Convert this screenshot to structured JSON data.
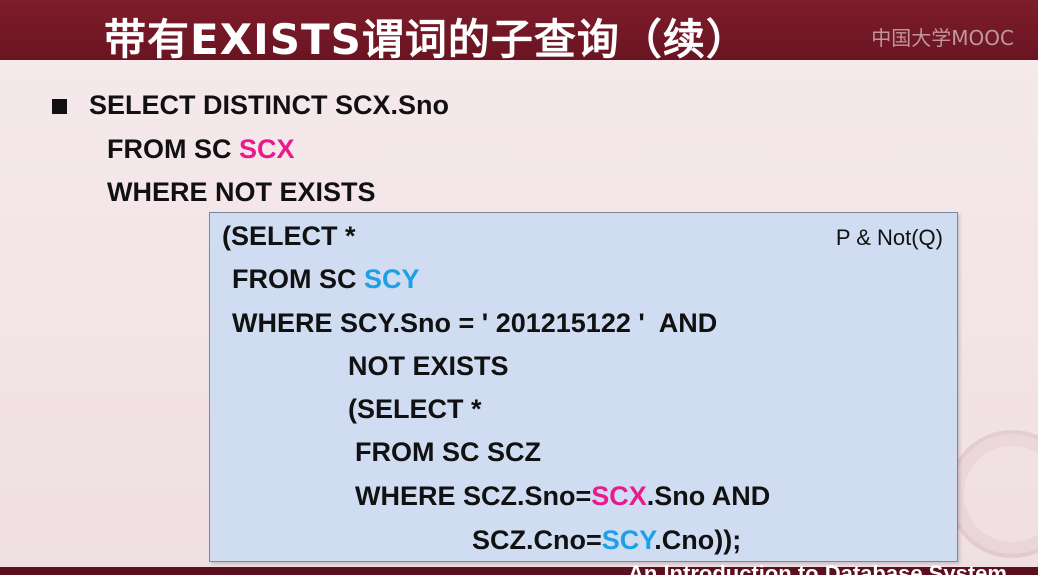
{
  "slide": {
    "title": "带有EXISTS谓词的子查询（续）",
    "watermark": "中国大学MOOC",
    "footer": "An Introduction to Database System"
  },
  "code": {
    "line1": "SELECT DISTINCT SCX.Sno",
    "line2_a": "FROM SC ",
    "line2_b": "SCX",
    "line3": "WHERE NOT EXISTS"
  },
  "subquery": {
    "annotation": "P & Not(Q)",
    "l1": "(SELECT *",
    "l2_a": "FROM SC ",
    "l2_b": "SCY",
    "l3": "WHERE SCY.Sno = ' 201215122 '  AND",
    "l4": "NOT EXISTS",
    "l5": "(SELECT *",
    "l6": "FROM SC SCZ",
    "l7_a": "WHERE SCZ.Sno=",
    "l7_b": "SCX",
    "l7_c": ".Sno AND",
    "l8_a": "SCZ.Cno=",
    "l8_b": "SCY",
    "l8_c": ".Cno));"
  },
  "colors": {
    "title_band": "#7e1d2b",
    "subquery_box": "#cfdcf2",
    "highlight_scx": "#ea1a8c",
    "highlight_scy": "#1ea0e6"
  }
}
